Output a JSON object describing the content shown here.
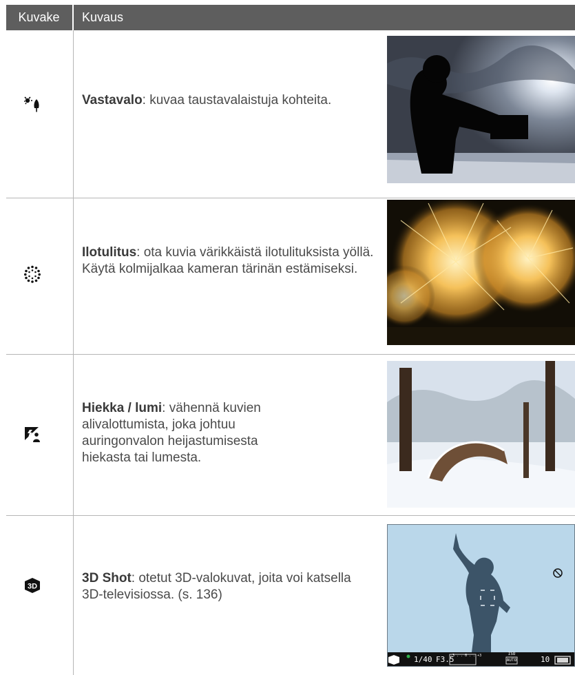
{
  "header": {
    "icon_col": "Kuvake",
    "desc_col": "Kuvaus"
  },
  "rows": [
    {
      "icon": "backlight-icon",
      "title": "Vastavalo",
      "text": ": kuvaa taustavalaistuja kohteita."
    },
    {
      "icon": "fireworks-icon",
      "title": "Ilotulitus",
      "text": ": ota kuvia värikkäistä ilotulituksista yöllä. Käytä kolmijalkaa kameran tärinän estämiseksi."
    },
    {
      "icon": "sand-snow-icon",
      "title": "Hiekka / lumi",
      "text": ": vähennä kuvien alivalottumista, joka johtuu auringonvalon heijastumisesta hiekasta tai lumesta."
    },
    {
      "icon": "3d-shot-icon",
      "title": "3D Shot",
      "text": ": otetut 3D-valokuvat, joita voi katsella 3D-televisiossa. (s. 136)"
    }
  ],
  "camera_screen": {
    "shutter": "1/40",
    "aperture": "F3.5",
    "ev_scale": "-3 . . 0 . . +3",
    "iso_top": "ISO",
    "iso_bottom": "AUTO",
    "shots": "10"
  }
}
